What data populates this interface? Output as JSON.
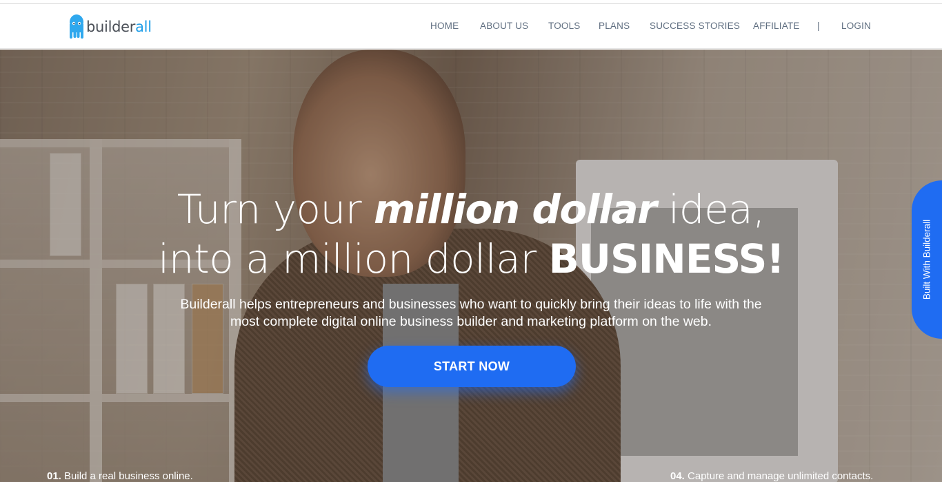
{
  "brand": {
    "name_main": "builder",
    "name_accent": "all",
    "colors": {
      "accent": "#1f9ee8",
      "primary": "#1f6cf2",
      "nav_text": "#5f6e80"
    }
  },
  "nav": {
    "items": [
      "HOME",
      "ABOUT US",
      "TOOLS",
      "PLANS",
      "SUCCESS STORIES",
      "AFFILIATE"
    ],
    "separator": "|",
    "login": "LOGIN"
  },
  "hero": {
    "line1_a": "Turn your ",
    "line1_em": "million dollar",
    "line1_b": " idea,",
    "line2_a": "into a million dollar ",
    "line2_strong": "BUSINESS!",
    "subtext_1": "Builderall helps entrepreneurs and businesses who want to quickly bring their ideas to life with the",
    "subtext_2": "most complete digital online business builder and marketing platform on the web.",
    "cta": "START NOW"
  },
  "side_tab": {
    "label": "Built With Builderall"
  },
  "features": [
    {
      "num": "01.",
      "text": " Build a real business online."
    },
    {
      "num": "04.",
      "text": " Capture and manage unlimited contacts."
    }
  ],
  "icons": {
    "logo": "octopus-mascot-icon"
  }
}
